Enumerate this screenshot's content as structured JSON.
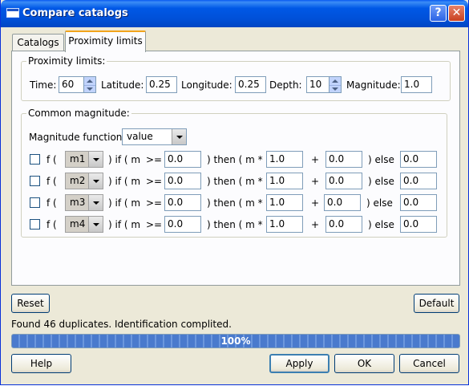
{
  "window": {
    "title": "Compare catalogs",
    "help_glyph": "?",
    "close_glyph": "✕"
  },
  "tabs": [
    {
      "label": "Catalogs"
    },
    {
      "label": "Proximity limits"
    }
  ],
  "proximity": {
    "group_title": "Proximity limits:",
    "time_label": "Time:",
    "time_value": "60",
    "latitude_label": "Latitude:",
    "latitude_value": "0.25",
    "longitude_label": "Longitude:",
    "longitude_value": "0.25",
    "depth_label": "Depth:",
    "depth_value": "10",
    "magnitude_label": "Magnitude:",
    "magnitude_value": "1.0"
  },
  "common": {
    "group_title": "Common magnitude:",
    "function_label": "Magnitude function:",
    "function_value": "value",
    "rows": [
      {
        "f_text": "f (",
        "mag": "m1",
        "if_text": ") if ( m",
        "op": ">=",
        "threshold": "0.0",
        "then_text": ") then ( m *",
        "mult": "1.0",
        "plus": "+",
        "add": "0.0",
        "else_text": ")  else",
        "else_value": "0.0"
      },
      {
        "f_text": "f (",
        "mag": "m2",
        "if_text": ") if ( m",
        "op": ">=",
        "threshold": "0.0",
        "then_text": ") then ( m *",
        "mult": "1.0",
        "plus": "+",
        "add": "0.0",
        "else_text": ")  else",
        "else_value": "0.0"
      },
      {
        "f_text": "f (",
        "mag": "m3",
        "if_text": ") if ( m",
        "op": ">=",
        "threshold": "0.0",
        "then_text": ") then ( m *",
        "mult": "1.0",
        "plus": "+",
        "add": "0.0",
        "else_text": ")  else",
        "else_value": "0.0"
      },
      {
        "f_text": "f (",
        "mag": "m4",
        "if_text": ") if ( m",
        "op": ">=",
        "threshold": "0.0",
        "then_text": ") then ( m *",
        "mult": "1.0",
        "plus": "+",
        "add": "0.0",
        "else_text": ")  else",
        "else_value": "0.0"
      }
    ]
  },
  "buttons": {
    "reset": "Reset",
    "default": "Default",
    "help": "Help",
    "apply": "Apply",
    "ok": "OK",
    "cancel": "Cancel"
  },
  "status": {
    "message": "Found 46 duplicates. Identification complited.",
    "progress_text": "100%",
    "progress_fraction": 1.0
  }
}
